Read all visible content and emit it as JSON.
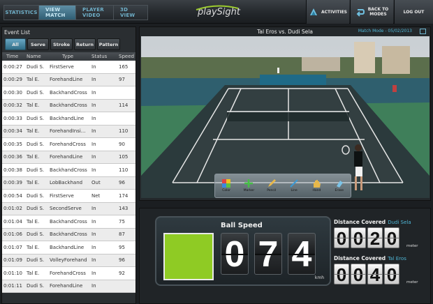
{
  "nav": {
    "tabs": [
      {
        "label": "STATISTICS",
        "active": false
      },
      {
        "label": "VIEW MATCH",
        "active": true
      },
      {
        "label": "PLAYER VIDEO",
        "active": false
      },
      {
        "label": "3D VIEW",
        "active": false
      }
    ],
    "logo": "playSight",
    "activities_label": "ACTIVITIES",
    "back_label": "BACK TO\nMODES",
    "logout_label": "LOG OUT"
  },
  "event_list": {
    "title": "Event List",
    "filters": [
      "All",
      "Serve",
      "Stroke",
      "Return",
      "Pattern"
    ],
    "active_filter": "All",
    "columns": [
      "Time",
      "Name",
      "Type",
      "Status",
      "Speed"
    ],
    "rows": [
      {
        "time": "0:00:27",
        "name": "Dudi S.",
        "type": "FirstServe",
        "status": "In",
        "speed": "165"
      },
      {
        "time": "0:00:29",
        "name": "Tal E.",
        "type": "ForehandLine",
        "status": "In",
        "speed": "97"
      },
      {
        "time": "0:00:30",
        "name": "Dudi S.",
        "type": "BackhandCross",
        "status": "In",
        "speed": ""
      },
      {
        "time": "0:00:32",
        "name": "Tal E.",
        "type": "BackhandCross",
        "status": "In",
        "speed": "114"
      },
      {
        "time": "0:00:33",
        "name": "Dudi S.",
        "type": "BackhandLine",
        "status": "In",
        "speed": ""
      },
      {
        "time": "0:00:34",
        "name": "Tal E.",
        "type": "ForehandInsi...",
        "status": "In",
        "speed": "110"
      },
      {
        "time": "0:00:35",
        "name": "Dudi S.",
        "type": "ForehandCross",
        "status": "In",
        "speed": "90"
      },
      {
        "time": "0:00:36",
        "name": "Tal E.",
        "type": "ForehandLine",
        "status": "In",
        "speed": "105"
      },
      {
        "time": "0:00:38",
        "name": "Dudi S.",
        "type": "BackhandCross",
        "status": "In",
        "speed": "110"
      },
      {
        "time": "0:00:39",
        "name": "Tal E.",
        "type": "LobBackhand",
        "status": "Out",
        "speed": "96"
      },
      {
        "time": "0:00:54",
        "name": "Dudi S.",
        "type": "FirstServe",
        "status": "Net",
        "speed": "174"
      },
      {
        "time": "0:01:02",
        "name": "Dudi S.",
        "type": "SecondServe",
        "status": "In",
        "speed": "143"
      },
      {
        "time": "0:01:04",
        "name": "Tal E.",
        "type": "BackhandCross",
        "status": "In",
        "speed": "75"
      },
      {
        "time": "0:01:06",
        "name": "Dudi S.",
        "type": "BackhandCross",
        "status": "In",
        "speed": "87"
      },
      {
        "time": "0:01:07",
        "name": "Tal E.",
        "type": "BackhandLine",
        "status": "In",
        "speed": "95"
      },
      {
        "time": "0:01:09",
        "name": "Dudi S.",
        "type": "VolleyForehand",
        "status": "In",
        "speed": "96"
      },
      {
        "time": "0:01:10",
        "name": "Tal E.",
        "type": "ForehandCross",
        "status": "In",
        "speed": "92"
      },
      {
        "time": "0:01:11",
        "name": "Dudi S.",
        "type": "ForehandLine",
        "status": "In",
        "speed": ""
      }
    ]
  },
  "video": {
    "title": "Tal Eros vs. Dudi Sela",
    "match_mode": "Match Mode - 05/02/2013",
    "tools": [
      {
        "label": "Color",
        "icon": "color-palette-icon"
      },
      {
        "label": "Marker",
        "icon": "plus-marker-icon"
      },
      {
        "label": "Pencil",
        "icon": "pencil-icon"
      },
      {
        "label": "Line",
        "icon": "line-icon"
      },
      {
        "label": "Hand",
        "icon": "hand-icon"
      },
      {
        "label": "Erase",
        "icon": "eraser-icon"
      }
    ]
  },
  "ball_speed": {
    "title": "Ball Speed",
    "digits": [
      "0",
      "7",
      "4"
    ],
    "unit": "kmh",
    "swatch_color": "#8fcb24"
  },
  "distance": [
    {
      "label": "Distance Covered",
      "player": "Dudi Sela",
      "digits": [
        "0",
        "0",
        "2",
        "0"
      ],
      "unit": "meter"
    },
    {
      "label": "Distance Covered",
      "player": "Tal Eros",
      "digits": [
        "0",
        "0",
        "4",
        "0"
      ],
      "unit": "meter"
    }
  ],
  "colors": {
    "accent": "#4fb6d6",
    "speed_green": "#8fcb24"
  }
}
